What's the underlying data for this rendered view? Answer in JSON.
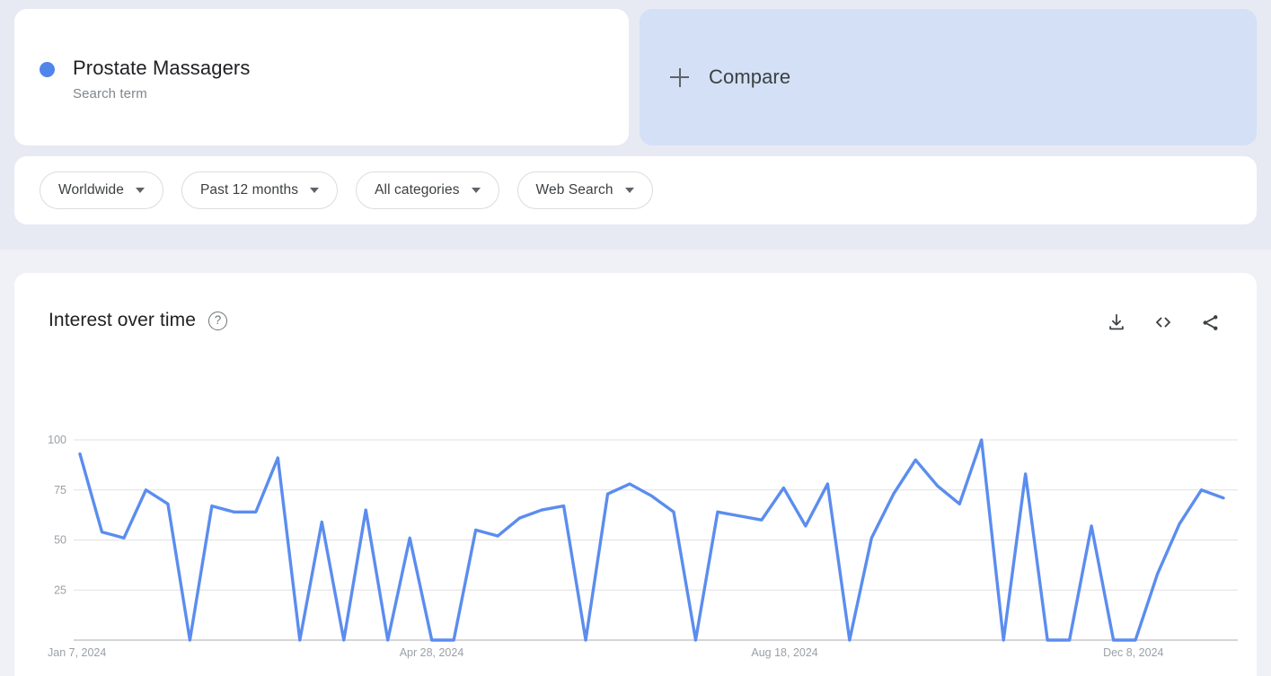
{
  "colors": {
    "accent": "#5085ec",
    "line": "#5b8def",
    "compare_card_bg": "#d3e0f5",
    "page_bg": "#eef1f7",
    "card_bg": "#ffffff",
    "grid": "#e0e0e0",
    "axis_text": "#9aa0a6"
  },
  "term_card": {
    "title": "Prostate Massagers",
    "subtitle": "Search term",
    "dot_icon": "series-color-dot"
  },
  "compare_card": {
    "label": "Compare",
    "icon": "plus-icon"
  },
  "filters": [
    {
      "name": "location",
      "label": "Worldwide",
      "icon": "chevron-down-icon"
    },
    {
      "name": "time-range",
      "label": "Past 12 months",
      "icon": "chevron-down-icon"
    },
    {
      "name": "category",
      "label": "All categories",
      "icon": "chevron-down-icon"
    },
    {
      "name": "search-type",
      "label": "Web Search",
      "icon": "chevron-down-icon"
    }
  ],
  "chart_panel": {
    "title": "Interest over time",
    "help_glyph": "?",
    "actions": [
      {
        "name": "download-csv-button",
        "icon": "download-icon"
      },
      {
        "name": "embed-code-button",
        "icon": "code-brackets-icon"
      },
      {
        "name": "share-button",
        "icon": "share-icon"
      }
    ]
  },
  "chart_data": {
    "type": "line",
    "title": "Interest over time",
    "xlabel": "",
    "ylabel": "",
    "ylim": [
      0,
      100
    ],
    "yticks": [
      25,
      50,
      75,
      100
    ],
    "ytick_labels": [
      "25",
      "50",
      "75",
      "100"
    ],
    "grid": true,
    "legend": "none",
    "series_name": "Prostate Massagers",
    "x_axis_labels": [
      "Jan 7, 2024",
      "Apr 28, 2024",
      "Aug 18, 2024",
      "Dec 8, 2024"
    ],
    "x_axis_label_positions": [
      0,
      16,
      32,
      48
    ],
    "n_points": 53,
    "values": [
      93,
      54,
      51,
      75,
      68,
      0,
      67,
      64,
      64,
      91,
      0,
      59,
      0,
      65,
      0,
      51,
      0,
      0,
      55,
      52,
      61,
      65,
      67,
      0,
      73,
      78,
      72,
      64,
      0,
      64,
      62,
      60,
      76,
      57,
      78,
      0,
      51,
      73,
      90,
      77,
      68,
      100,
      0,
      83,
      0,
      0,
      57,
      0,
      0,
      33,
      58,
      75,
      71
    ]
  }
}
